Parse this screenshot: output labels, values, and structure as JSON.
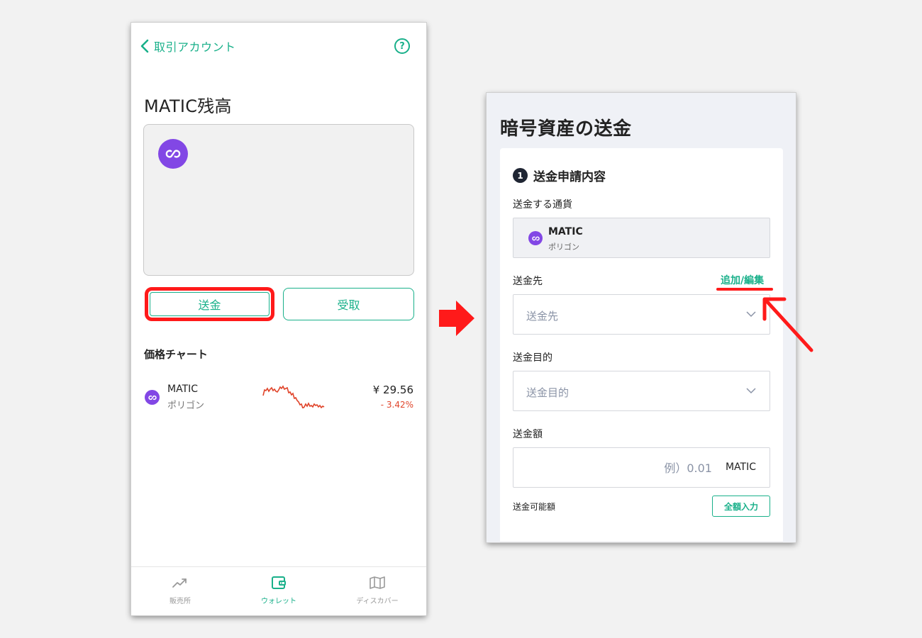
{
  "mobile": {
    "header": {
      "back_label": "取引アカウント",
      "help_symbol": "?"
    },
    "title": "MATIC残高",
    "buttons": {
      "send": "送金",
      "receive": "受取"
    },
    "chart_section_title": "価格チャート",
    "coin_row": {
      "name": "MATIC",
      "subname": "ポリゴン",
      "price": "¥ 29.56",
      "change": "- 3.42%",
      "change_color": "#e0452b"
    },
    "tabbar": [
      {
        "label": "販売所",
        "icon": "trend-icon",
        "active": false
      },
      {
        "label": "ウォレット",
        "icon": "wallet-icon",
        "active": true
      },
      {
        "label": "ディスカバー",
        "icon": "map-icon",
        "active": false
      }
    ]
  },
  "web": {
    "title": "暗号資産の送金",
    "step": {
      "number": "1",
      "title": "送金申請内容"
    },
    "currency": {
      "label": "送金する通貨",
      "name": "MATIC",
      "subname": "ポリゴン"
    },
    "destination": {
      "label": "送金先",
      "add_edit_link": "追加/編集",
      "placeholder": "送金先"
    },
    "purpose": {
      "label": "送金目的",
      "placeholder": "送金目的"
    },
    "amount": {
      "label": "送金額",
      "placeholder": "例）0.01",
      "unit": "MATIC",
      "available_label": "送金可能額",
      "fill_all_button": "全額入力"
    }
  },
  "colors": {
    "accent": "#19b08a",
    "highlight_red": "#ff1a1a",
    "polygon_purple": "#8247e5",
    "down_red": "#e0452b"
  }
}
